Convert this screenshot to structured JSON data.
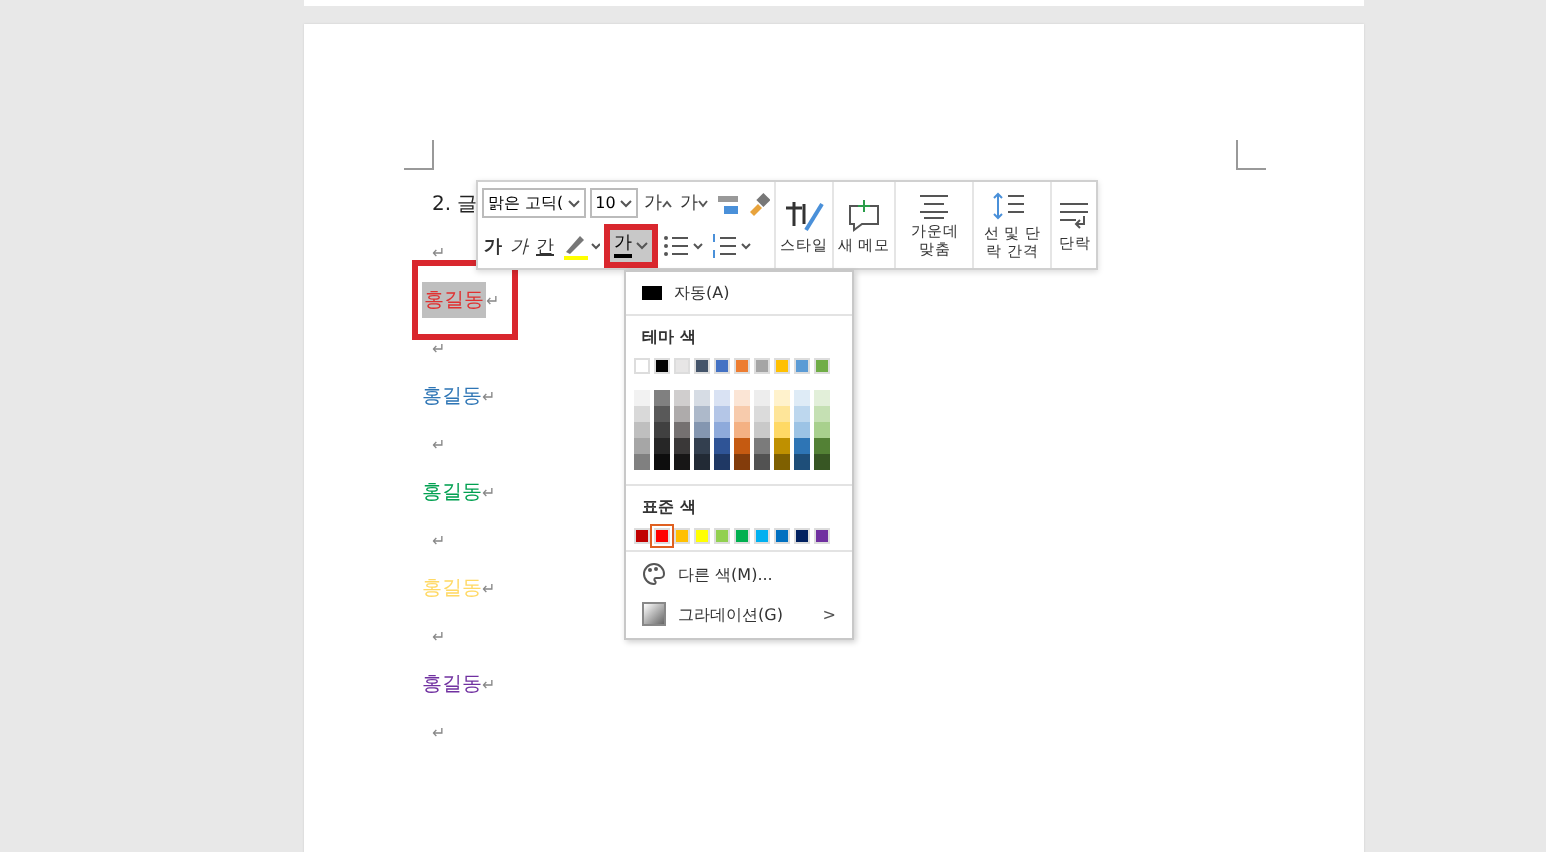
{
  "document": {
    "heading": "2. 글",
    "lines": [
      {
        "kind": "empty",
        "mark": "↵"
      },
      {
        "kind": "text",
        "text": "홍길동",
        "mark": "↵",
        "color": "#e03030",
        "highlighted": true,
        "annotated": true
      },
      {
        "kind": "empty",
        "mark": "↵"
      },
      {
        "kind": "text",
        "text": "홍길동",
        "mark": "↵",
        "color": "#2e75b5",
        "highlighted": false,
        "annotated": false
      },
      {
        "kind": "empty",
        "mark": "↵"
      },
      {
        "kind": "text",
        "text": "홍길동",
        "mark": "↵",
        "color": "#00a050",
        "highlighted": false,
        "annotated": false
      },
      {
        "kind": "empty",
        "mark": "↵"
      },
      {
        "kind": "text",
        "text": "홍길동",
        "mark": "↵",
        "color": "#ffd965",
        "highlighted": false,
        "annotated": false
      },
      {
        "kind": "empty",
        "mark": "↵"
      },
      {
        "kind": "text",
        "text": "홍길동",
        "mark": "↵",
        "color": "#7030a0",
        "highlighted": false,
        "annotated": false
      },
      {
        "kind": "empty",
        "mark": "↵"
      }
    ]
  },
  "toolbar": {
    "font": "맑은 고딕(",
    "size": "10",
    "grow": "가",
    "shrink": "가",
    "bold": "가",
    "italic": "가",
    "underline": "간",
    "font_color": {
      "label": "가",
      "annotated": true,
      "selected": true
    },
    "big_buttons": [
      {
        "kind": "style",
        "label": "스타일"
      },
      {
        "kind": "memo",
        "label": "새 메모"
      },
      {
        "kind": "center",
        "label": "가운데 맞춤"
      },
      {
        "kind": "spacing",
        "label": "선 및 단락 간격"
      },
      {
        "kind": "paragraph",
        "label": "단락"
      }
    ]
  },
  "color_menu": {
    "auto": "자동(A)",
    "theme_title": "테마 색",
    "theme": [
      {
        "color": "#ffffff",
        "shades": [
          {
            "color": "#f2f2f2"
          },
          {
            "color": "#d9d9d9"
          },
          {
            "color": "#bfbfbf"
          },
          {
            "color": "#a6a6a6"
          },
          {
            "color": "#808080"
          }
        ]
      },
      {
        "color": "#000000",
        "shades": [
          {
            "color": "#808080"
          },
          {
            "color": "#595959"
          },
          {
            "color": "#404040"
          },
          {
            "color": "#262626"
          },
          {
            "color": "#0d0d0d"
          }
        ]
      },
      {
        "color": "#e7e6e6",
        "shades": [
          {
            "color": "#d0cece"
          },
          {
            "color": "#aeabab"
          },
          {
            "color": "#757171"
          },
          {
            "color": "#3a3838"
          },
          {
            "color": "#171616"
          }
        ]
      },
      {
        "color": "#44546a",
        "shades": [
          {
            "color": "#d6dce4"
          },
          {
            "color": "#adb9ca"
          },
          {
            "color": "#8496b0"
          },
          {
            "color": "#333f4f"
          },
          {
            "color": "#222a35"
          }
        ]
      },
      {
        "color": "#4472c4",
        "shades": [
          {
            "color": "#d9e2f3"
          },
          {
            "color": "#b4c6e7"
          },
          {
            "color": "#8eaadb"
          },
          {
            "color": "#2f5496"
          },
          {
            "color": "#1f3864"
          }
        ]
      },
      {
        "color": "#ed7d31",
        "shades": [
          {
            "color": "#fbe5d5"
          },
          {
            "color": "#f7cbac"
          },
          {
            "color": "#f4b183"
          },
          {
            "color": "#c55a11"
          },
          {
            "color": "#833c0b"
          }
        ]
      },
      {
        "color": "#a5a5a5",
        "shades": [
          {
            "color": "#ededed"
          },
          {
            "color": "#dbdbdb"
          },
          {
            "color": "#c9c9c9"
          },
          {
            "color": "#7b7b7b"
          },
          {
            "color": "#525252"
          }
        ]
      },
      {
        "color": "#ffc000",
        "shades": [
          {
            "color": "#fff2cc"
          },
          {
            "color": "#fee599"
          },
          {
            "color": "#ffd965"
          },
          {
            "color": "#bf9000"
          },
          {
            "color": "#7f6000"
          }
        ]
      },
      {
        "color": "#5b9bd5",
        "shades": [
          {
            "color": "#deebf6"
          },
          {
            "color": "#bdd7ee"
          },
          {
            "color": "#9cc3e5"
          },
          {
            "color": "#2e75b5"
          },
          {
            "color": "#1e4e79"
          }
        ]
      },
      {
        "color": "#70ad47",
        "shades": [
          {
            "color": "#e2efd9"
          },
          {
            "color": "#c5e0b3"
          },
          {
            "color": "#a8d08d"
          },
          {
            "color": "#538135"
          },
          {
            "color": "#375623"
          }
        ]
      }
    ],
    "standard_title": "표준 색",
    "standard": [
      {
        "color": "#c00000",
        "selected": false
      },
      {
        "color": "#ff0000",
        "selected": true
      },
      {
        "color": "#ffc000",
        "selected": false
      },
      {
        "color": "#ffff00",
        "selected": false
      },
      {
        "color": "#92d050",
        "selected": false
      },
      {
        "color": "#00b050",
        "selected": false
      },
      {
        "color": "#00b0f0",
        "selected": false
      },
      {
        "color": "#0070c0",
        "selected": false
      },
      {
        "color": "#002060",
        "selected": false
      },
      {
        "color": "#7030a0",
        "selected": false
      }
    ],
    "more": "다른 색(M)...",
    "gradient": "그라데이션(G)",
    "gradient_arrow": ">"
  }
}
